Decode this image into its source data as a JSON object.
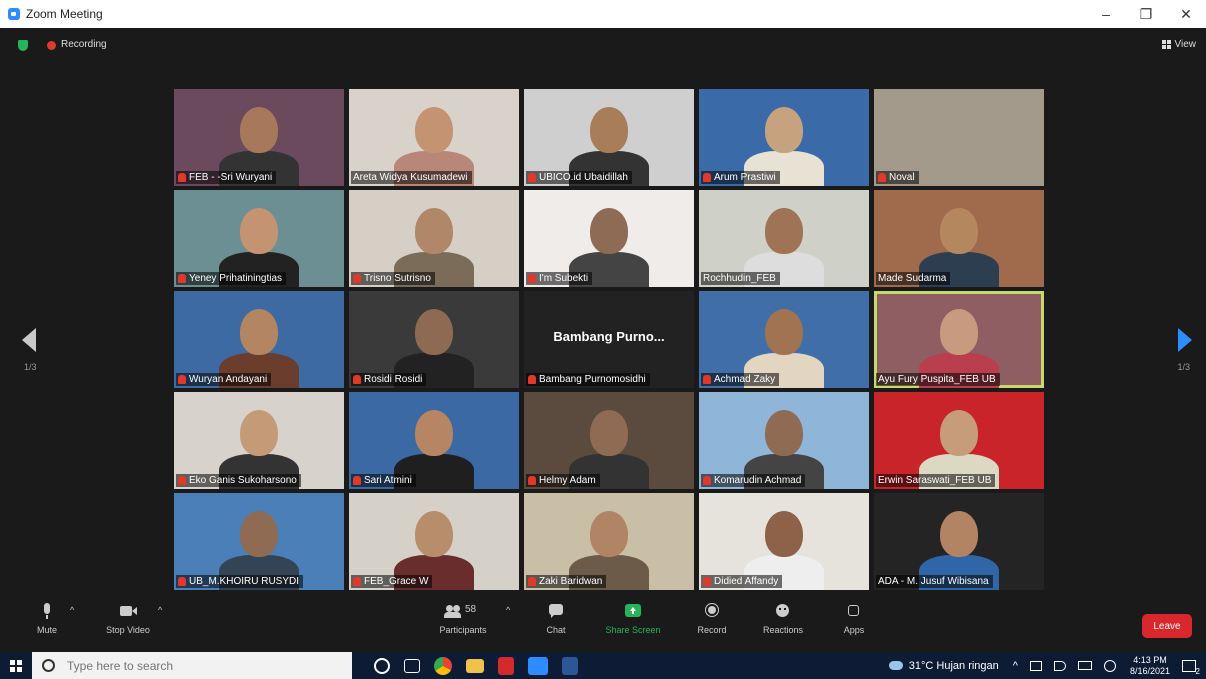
{
  "window": {
    "title": "Zoom Meeting",
    "minimize": "–",
    "restore": "❐",
    "close": "✕"
  },
  "topbar": {
    "recording_label": "Recording",
    "view_label": "View"
  },
  "nav": {
    "page_left": "1/3",
    "page_right": "1/3"
  },
  "tiles": [
    {
      "name": "FEB - -Sri Wuryani",
      "muted": true,
      "bg": "#6b4a5e",
      "skin": "#a7785a",
      "shirt": "#333"
    },
    {
      "name": "Areta Widya Kusumadewi",
      "muted": false,
      "bg": "#d9d2cb",
      "skin": "#c49372",
      "shirt": "#b98678"
    },
    {
      "name": "UBICO.id Ubaidillah",
      "muted": true,
      "bg": "#cfcfcf",
      "skin": "#a77d5a",
      "shirt": "#333"
    },
    {
      "name": "Arum Prastiwi",
      "muted": true,
      "bg": "#3b6aa8",
      "skin": "#c7a27f",
      "shirt": "#e8e2d5"
    },
    {
      "name": "Noval",
      "muted": true,
      "bg": "#a49a8c",
      "skin": "#a49a8c",
      "shirt": "#a49a8c"
    },
    {
      "name": "Yeney Prihatiningtias",
      "muted": true,
      "bg": "#6c8f93",
      "skin": "#c49372",
      "shirt": "#222"
    },
    {
      "name": "Trisno Sutrisno",
      "muted": true,
      "bg": "#d5cfc5",
      "skin": "#b08768",
      "shirt": "#7b6b59"
    },
    {
      "name": "I'm Subekti",
      "muted": true,
      "bg": "#f0ecea",
      "skin": "#8d6b54",
      "shirt": "#444"
    },
    {
      "name": "Rochhudin_FEB",
      "muted": false,
      "bg": "#cfd0c8",
      "skin": "#9e7356",
      "shirt": "#ddd"
    },
    {
      "name": "Made Sudarma",
      "muted": false,
      "bg": "#a06a4d",
      "skin": "#b4875f",
      "shirt": "#2c3e50"
    },
    {
      "name": "Wuryan Andayani",
      "muted": true,
      "bg": "#3d6aa3",
      "skin": "#b48562",
      "shirt": "#6a3d2d"
    },
    {
      "name": "Rosidi Rosidi",
      "muted": true,
      "bg": "#3a3a3a",
      "skin": "#8f6a52",
      "shirt": "#222"
    },
    {
      "name": "Bambang Purnomosidhi",
      "muted": true,
      "bg": "#222222",
      "skin": "",
      "shirt": "",
      "display": "Bambang  Purno..."
    },
    {
      "name": "Achmad Zaky",
      "muted": true,
      "bg": "#3f6ea8",
      "skin": "#a17352",
      "shirt": "#e2d6c3"
    },
    {
      "name": "Ayu Fury Puspita_FEB UB",
      "muted": false,
      "bg": "#8e5e62",
      "skin": "#c89a80",
      "shirt": "#b93f4e",
      "highlight": true
    },
    {
      "name": "Eko Ganis Sukoharsono",
      "muted": true,
      "bg": "#d7d2cc",
      "skin": "#c59a76",
      "shirt": "#333"
    },
    {
      "name": "Sari Atmini",
      "muted": true,
      "bg": "#3b69a3",
      "skin": "#b68563",
      "shirt": "#1f1f1f"
    },
    {
      "name": "Helmy Adam",
      "muted": true,
      "bg": "#5b4a3e",
      "skin": "#8e6b52",
      "shirt": "#333"
    },
    {
      "name": "Komarudin Achmad",
      "muted": true,
      "bg": "#8fb6d8",
      "skin": "#8e6b52",
      "shirt": "#444"
    },
    {
      "name": "Erwin Saraswati_FEB UB",
      "muted": false,
      "bg": "#c8242a",
      "skin": "#c69c7a",
      "shirt": "#dcd8c4"
    },
    {
      "name": "UB_M.KHOIRU RUSYDI",
      "muted": true,
      "bg": "#4a7fb8",
      "skin": "#8e6b52",
      "shirt": "#345"
    },
    {
      "name": "FEB_Grace W",
      "muted": true,
      "bg": "#d6d1c8",
      "skin": "#b88d6c",
      "shirt": "#6a2d2d"
    },
    {
      "name": "Zaki Baridwan",
      "muted": true,
      "bg": "#c9bfa6",
      "skin": "#b08464",
      "shirt": "#6b5b48"
    },
    {
      "name": "Didied Affandy",
      "muted": true,
      "bg": "#e6e2dc",
      "skin": "#8e6248",
      "shirt": "#eee"
    },
    {
      "name": "ADA - M. Jusuf Wibisana",
      "muted": false,
      "bg": "#242424",
      "skin": "#b28463",
      "shirt": "#2f66a8"
    }
  ],
  "toolbar": {
    "mute": "Mute",
    "stop_video": "Stop Video",
    "participants": "Participants",
    "participants_count": "58",
    "chat": "Chat",
    "share_screen": "Share Screen",
    "record": "Record",
    "reactions": "Reactions",
    "apps": "Apps",
    "leave": "Leave"
  },
  "taskbar": {
    "search_placeholder": "Type here to search",
    "weather": "31°C  Hujan ringan",
    "time": "4:13 PM",
    "date": "8/16/2021",
    "notifications": "2"
  }
}
